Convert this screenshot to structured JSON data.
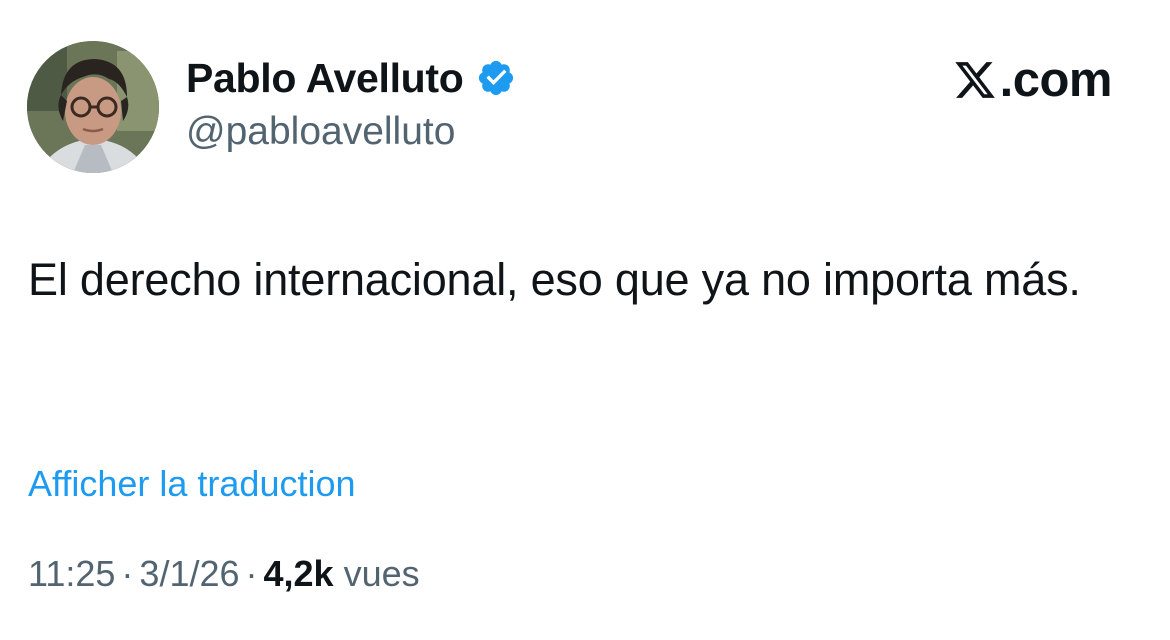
{
  "author": {
    "display_name": "Pablo Avelluto",
    "handle": "@pabloavelluto",
    "verified": true,
    "verified_color": "#1d9bf0",
    "avatar_icon": "profile-photo"
  },
  "brand": {
    "logo_icon": "x-logo-icon",
    "text": ".com"
  },
  "tweet": {
    "text": "El derecho internacional, eso que ya no importa más.",
    "translate_label": "Afficher la traduction",
    "time": "11:25",
    "date": "3/1/26",
    "separator": "·",
    "views_count": "4,2k",
    "views_label": "vues"
  },
  "colors": {
    "text": "#0f1419",
    "secondary": "#536471",
    "link": "#1d9bf0"
  }
}
